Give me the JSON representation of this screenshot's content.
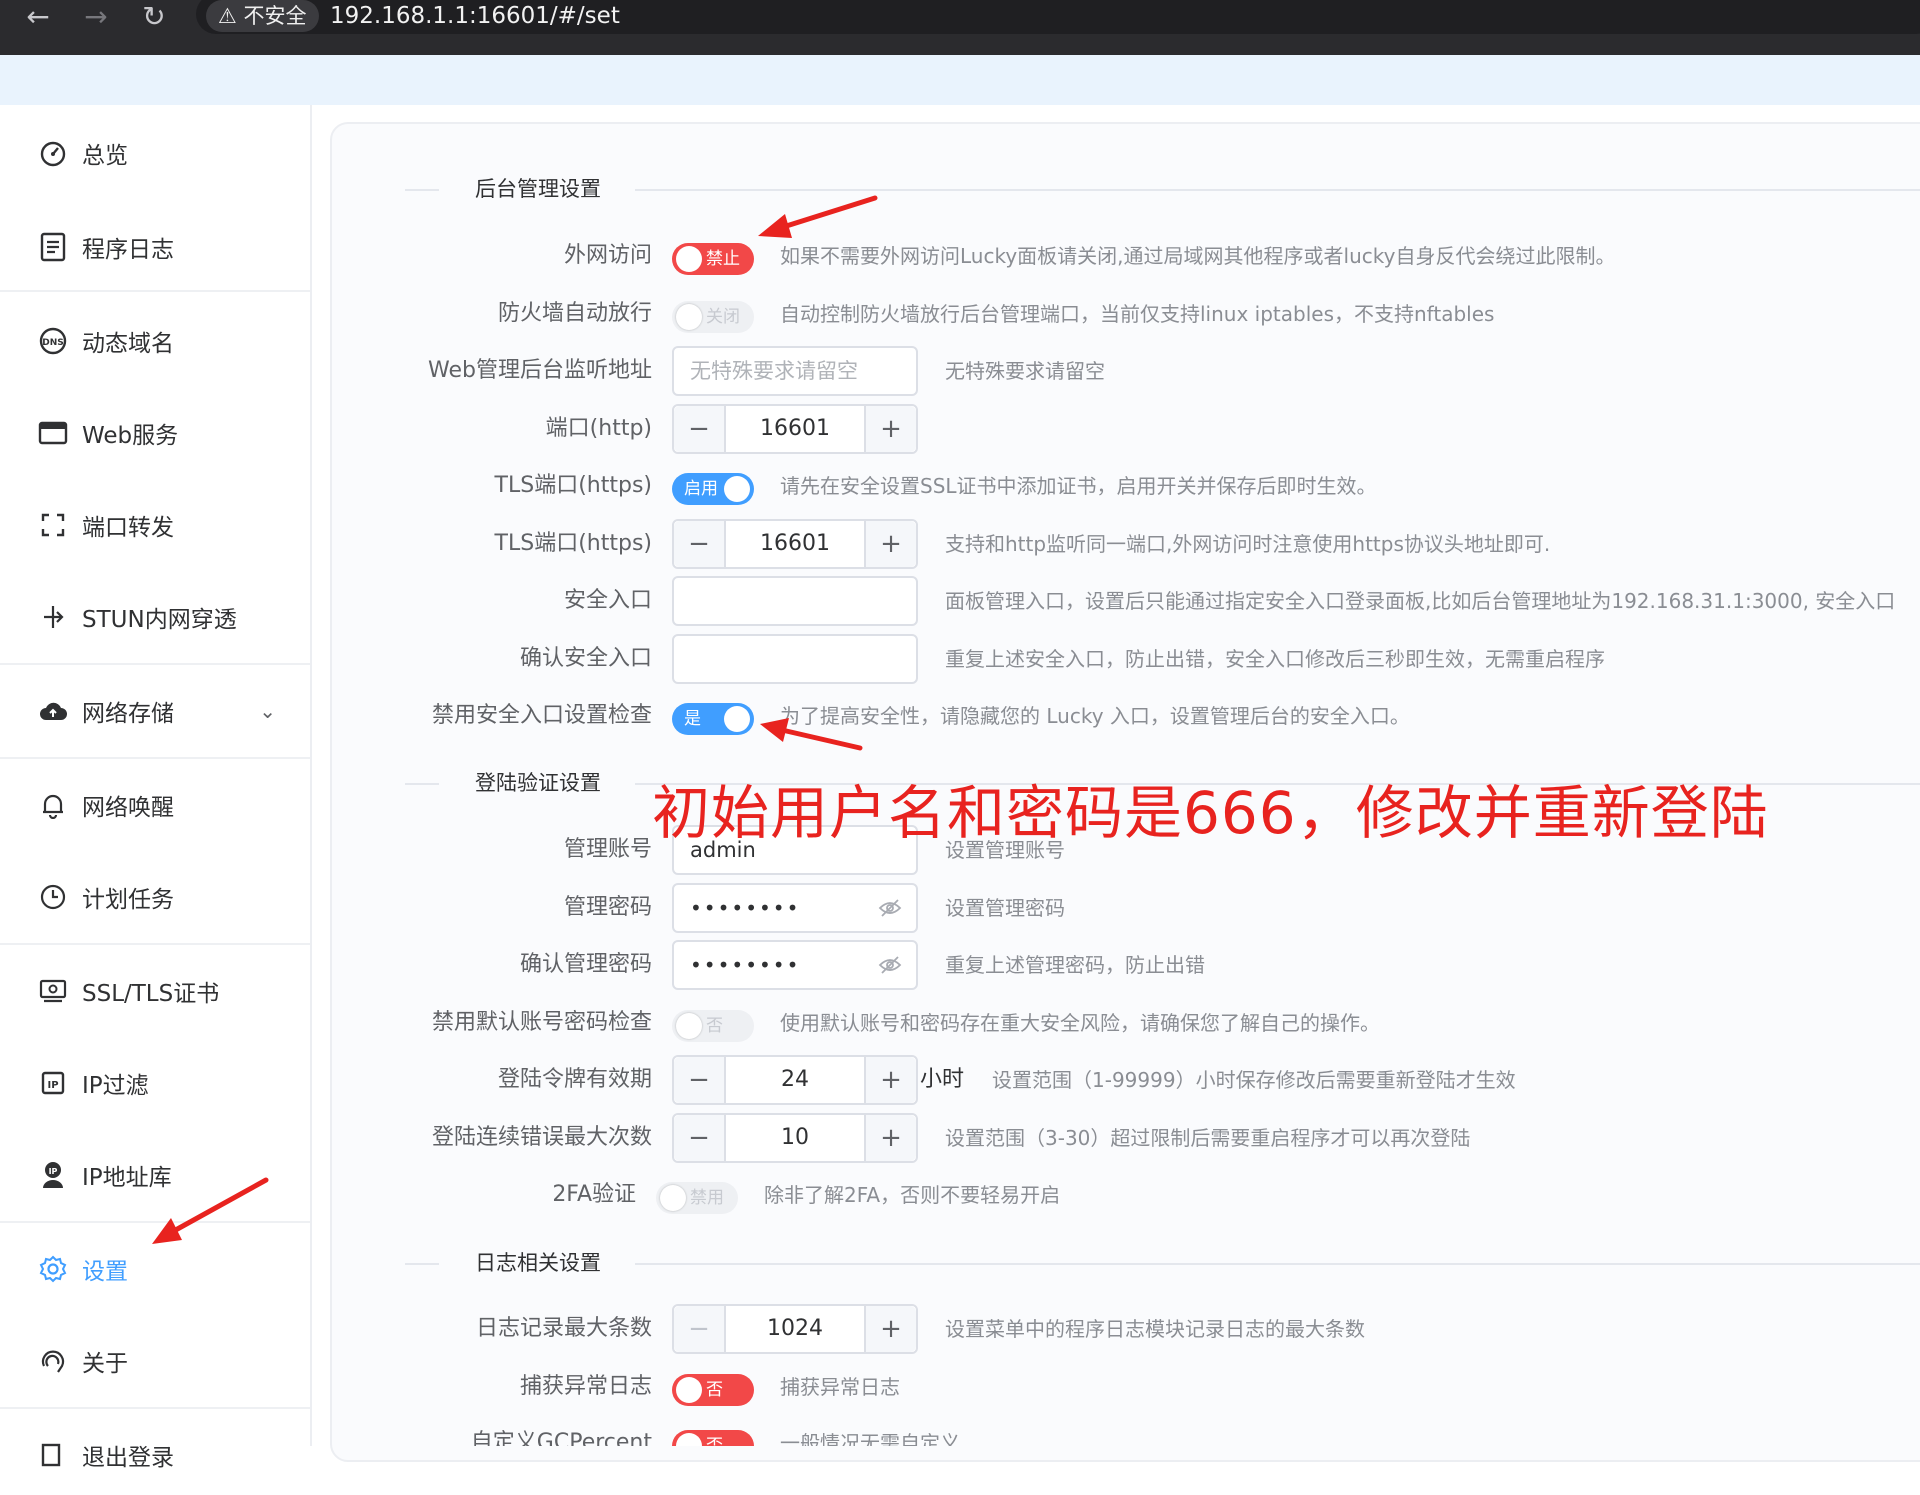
{
  "browser": {
    "back": "←",
    "forward": "→",
    "reload": "↻",
    "security_label": "⚠ 不安全",
    "url": "192.168.1.1:16601/#/set"
  },
  "sidebar": {
    "items": [
      {
        "label": "总览",
        "icon": "dashboard-icon"
      },
      {
        "label": "程序日志",
        "icon": "log-icon"
      },
      {
        "label": "动态域名",
        "icon": "dns-icon"
      },
      {
        "label": "Web服务",
        "icon": "web-icon"
      },
      {
        "label": "端口转发",
        "icon": "port-forward-icon"
      },
      {
        "label": "STUN内网穿透",
        "icon": "stun-icon"
      },
      {
        "label": "网络存储",
        "icon": "cloud-icon"
      },
      {
        "label": "网络唤醒",
        "icon": "bell-icon"
      },
      {
        "label": "计划任务",
        "icon": "clock-icon"
      },
      {
        "label": "SSL/TLS证书",
        "icon": "certificate-icon"
      },
      {
        "label": "IP过滤",
        "icon": "ip-filter-icon"
      },
      {
        "label": "IP地址库",
        "icon": "ip-db-icon"
      },
      {
        "label": "设置",
        "icon": "gear-icon"
      },
      {
        "label": "关于",
        "icon": "about-icon"
      },
      {
        "label": "退出登录",
        "icon": "logout-icon"
      }
    ]
  },
  "sections": {
    "admin": "后台管理设置",
    "login": "登陆验证设置",
    "log": "日志相关设置"
  },
  "admin": {
    "wan": {
      "label": "外网访问",
      "switch": "禁止",
      "hint": "如果不需要外网访问Lucky面板请关闭,通过局域网其他程序或者lucky自身反代会绕过此限制。"
    },
    "firewall": {
      "label": "防火墙自动放行",
      "switch": "关闭",
      "hint": "自动控制防火墙放行后台管理端口，当前仅支持linux iptables，不支持nftables"
    },
    "listen": {
      "label": "Web管理后台监听地址",
      "placeholder": "无特殊要求请留空",
      "hint": "无特殊要求请留空"
    },
    "http_port": {
      "label": "端口(http)",
      "value": "16601"
    },
    "tls_switch": {
      "label": "TLS端口(https)",
      "switch": "启用",
      "hint": "请先在安全设置SSL证书中添加证书，启用开关并保存后即时生效。"
    },
    "tls_port": {
      "label": "TLS端口(https)",
      "value": "16601",
      "hint": "支持和http监听同一端口,外网访问时注意使用https协议头地址即可."
    },
    "entry": {
      "label": "安全入口",
      "value": "",
      "hint": "面板管理入口，设置后只能通过指定安全入口登录面板,比如后台管理地址为192.168.31.1:3000, 安全入口"
    },
    "entry_confirm": {
      "label": "确认安全入口",
      "value": "",
      "hint": "重复上述安全入口，防止出错，安全入口修改后三秒即生效，无需重启程序"
    },
    "entry_check": {
      "label": "禁用安全入口设置检查",
      "switch": "是",
      "hint": "为了提高安全性，请隐藏您的 Lucky 入口，设置管理后台的安全入口。"
    }
  },
  "login": {
    "account": {
      "label": "管理账号",
      "value": "admin",
      "hint": "设置管理账号"
    },
    "password": {
      "label": "管理密码",
      "value": "••••••••",
      "hint": "设置管理密码"
    },
    "password_confirm": {
      "label": "确认管理密码",
      "value": "••••••••",
      "hint": "重复上述管理密码，防止出错"
    },
    "default_check": {
      "label": "禁用默认账号密码检查",
      "switch": "否",
      "hint": "使用默认账号和密码存在重大安全风险，请确保您了解自己的操作。"
    },
    "token": {
      "label": "登陆令牌有效期",
      "value": "24",
      "unit": "小时",
      "hint": "设置范围（1-99999）小时保存修改后需要重新登陆才生效"
    },
    "max_errors": {
      "label": "登陆连续错误最大次数",
      "value": "10",
      "hint": "设置范围（3-30）超过限制后需要重启程序才可以再次登陆"
    },
    "twofa": {
      "label": "2FA验证",
      "switch": "禁用",
      "hint": "除非了解2FA，否则不要轻易开启"
    }
  },
  "log": {
    "max": {
      "label": "日志记录最大条数",
      "value": "1024",
      "hint": "设置菜单中的程序日志模块记录日志的最大条数"
    },
    "capture": {
      "label": "捕获异常日志",
      "switch": "否",
      "hint": "捕获异常日志"
    },
    "gc": {
      "label": "自定义GCPercent",
      "switch": "否",
      "hint": "一般情况无需自定义"
    }
  },
  "annotation": "初始用户名和密码是666，修改并重新登陆",
  "colors": {
    "accent": "#409eff",
    "danger": "#f24848",
    "annotation": "#e8231f"
  }
}
